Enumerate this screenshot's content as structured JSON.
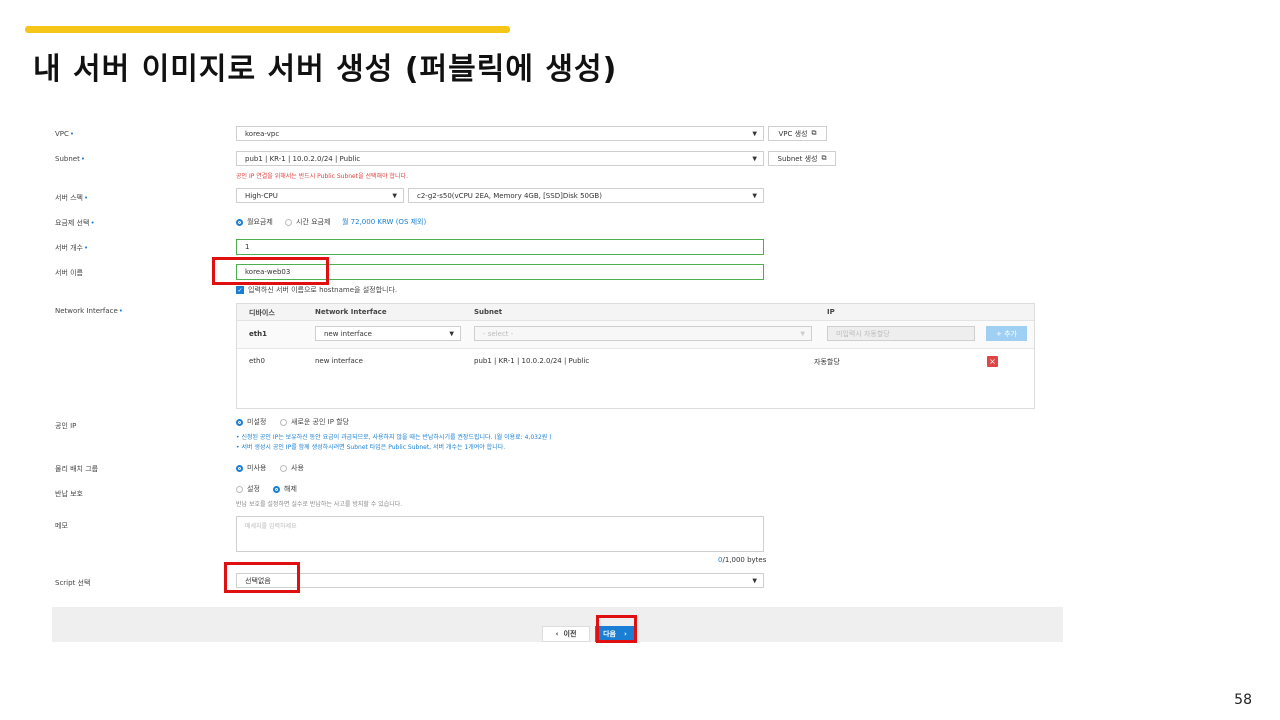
{
  "slide": {
    "title": "내 서버 이미지로 서버 생성  (퍼블릭에 생성)",
    "page_number": "58"
  },
  "form": {
    "vpc": {
      "label": "VPC",
      "value": "korea-vpc",
      "create_button": "VPC 생성"
    },
    "subnet": {
      "label": "Subnet",
      "value": "pub1 | KR-1 | 10.0.2.0/24 | Public",
      "create_button": "Subnet 생성",
      "warning": "공인 IP 연결을 위해서는 반드시 Public Subnet을 선택해야 합니다."
    },
    "server_spec": {
      "label": "서버 스펙",
      "type": "High-CPU",
      "spec": "c2-g2-s50(vCPU 2EA, Memory 4GB, [SSD]Disk 50GB)"
    },
    "billing": {
      "label": "요금제 선택",
      "option_monthly": "월요금제",
      "option_hourly": "시간 요금제",
      "price": "월 72,000 KRW (OS 제외)"
    },
    "server_count": {
      "label": "서버 개수",
      "value": "1"
    },
    "server_name": {
      "label": "서버 이름",
      "value": "korea-web03",
      "hostname_checkbox": "입력하신 서버 이름으로 hostname을 설정합니다."
    },
    "network_interface": {
      "label": "Network Interface",
      "headers": {
        "device": "디바이스",
        "ni": "Network Interface",
        "subnet": "Subnet",
        "ip": "IP"
      },
      "edit_row": {
        "device": "eth1",
        "ni": "new interface",
        "subnet_placeholder": "- select -",
        "ip_placeholder": "미입력시 자동할당",
        "add_button": "+ 추가"
      },
      "rows": [
        {
          "device": "eth0",
          "ni": "new interface",
          "subnet": "pub1 | KR-1 | 10.0.2.0/24 | Public",
          "ip": "자동할당"
        }
      ]
    },
    "public_ip": {
      "label": "공인 IP",
      "option_none": "미설정",
      "option_new": "새로운 공인 IP 할당",
      "note1": "• 신청된 공인 IP는 보유하신 동안 요금이 과금되므로, 사용하지 않을 때는 반납하시기를 권장드립니다. (월 이용료: 4,032원 )",
      "note2": "• 서버 생성시 공인 IP를 함께 생성하시려면 Subnet 타입은 Public Subnet, 서버 개수는 1개여야 합니다."
    },
    "placement_group": {
      "label": "물리 배치 그룹",
      "option_off": "미사용",
      "option_on": "사용"
    },
    "return_protection": {
      "label": "반납 보호",
      "option_on": "설정",
      "option_off": "해제",
      "note": "반납 보호를 설정하면 실수로 반납하는 사고를 방지할 수 있습니다."
    },
    "memo": {
      "label": "메모",
      "placeholder": "메세지를 입력하세요",
      "bytes_used": "0",
      "bytes_total": "/1,000 bytes"
    },
    "script": {
      "label": "Script 선택",
      "value": "선택없음"
    }
  },
  "footer": {
    "prev": "이전",
    "next": "다음"
  },
  "colors": {
    "accent": "#1a7fd4",
    "highlight": "#e01010",
    "title_bar": "#f5c518"
  }
}
